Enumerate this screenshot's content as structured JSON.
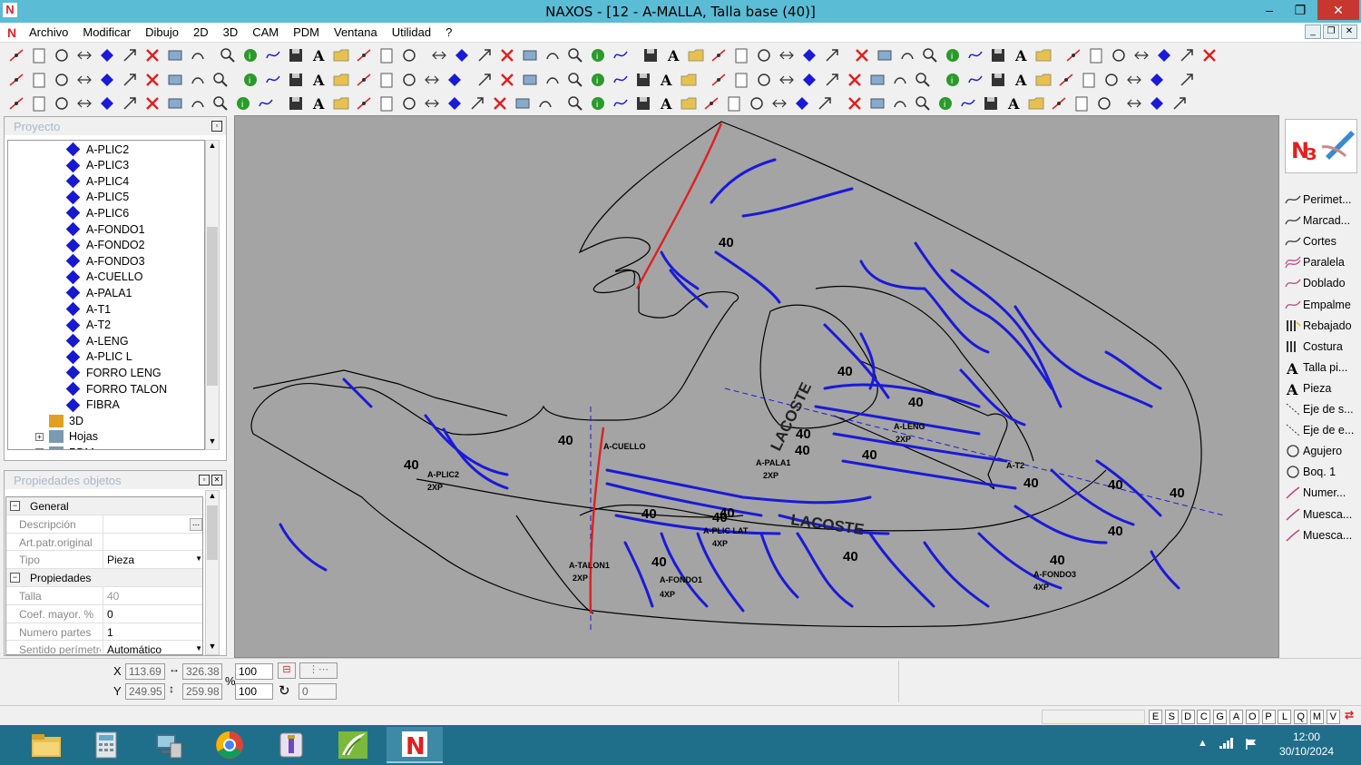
{
  "window": {
    "title": "NAXOS - [12 - A-MALLA, Talla base (40)]",
    "minimize": "–",
    "restore": "❐",
    "close": "✕"
  },
  "menu": {
    "items": [
      "Archivo",
      "Modificar",
      "Dibujo",
      "2D",
      "3D",
      "CAM",
      "PDM",
      "Ventana",
      "Utilidad",
      "?"
    ]
  },
  "project": {
    "header": "Proyecto",
    "items": [
      "A-PLIC2",
      "A-PLIC3",
      "A-PLIC4",
      "A-PLIC5",
      "A-PLIC6",
      "A-FONDO1",
      "A-FONDO2",
      "A-FONDO3",
      "A-CUELLO",
      "A-PALA1",
      "A-T1",
      "A-T2",
      "A-LENG",
      "A-PLIC L",
      "FORRO LENG",
      "FORRO TALON",
      "FIBRA"
    ],
    "folders": [
      "3D",
      "Hojas",
      "PDM"
    ]
  },
  "properties": {
    "header": "Propiedades objetos",
    "rows": [
      {
        "type": "group",
        "key": "General"
      },
      {
        "type": "row",
        "key": "Descripción",
        "value": "",
        "button": "..."
      },
      {
        "type": "row",
        "key": "Art.patr.original",
        "value": ""
      },
      {
        "type": "row",
        "key": "Tipo",
        "value": "Pieza",
        "dropdown": true
      },
      {
        "type": "group",
        "key": "Propiedades"
      },
      {
        "type": "row",
        "key": "Talla",
        "value": "40",
        "gray": true
      },
      {
        "type": "row",
        "key": "Coef. mayor. %",
        "value": "0"
      },
      {
        "type": "row",
        "key": "Numero partes",
        "value": "1"
      },
      {
        "type": "row",
        "key": "Sentido perímetro",
        "value": "Automático",
        "dropdown": true
      }
    ]
  },
  "palette": {
    "items": [
      "Perimet...",
      "Marcad...",
      "Cortes",
      "Paralela",
      "Doblado",
      "Empalme",
      "Rebajado",
      "Costura",
      "Talla pi...",
      "Pieza",
      "Eje de s...",
      "Eje de e...",
      "Agujero",
      "Boq. 1",
      "Numer...",
      "Muesca...",
      "Muesca..."
    ]
  },
  "coords": {
    "x_label": "X",
    "y_label": "Y",
    "x": "113.69",
    "y": "249.95",
    "w": "326.38",
    "h": "259.98",
    "pct_label": "%",
    "scale_x": "100",
    "scale_y": "100",
    "rotation": "0"
  },
  "status": {
    "keys": [
      "E",
      "S",
      "D",
      "C",
      "G",
      "A",
      "O",
      "P",
      "L",
      "Q",
      "M",
      "V"
    ]
  },
  "drawing": {
    "sizes": [
      "40",
      "40",
      "40",
      "40",
      "40",
      "40",
      "40",
      "40",
      "40",
      "40",
      "40",
      "40",
      "40",
      "40",
      "40",
      "40",
      "40",
      "40"
    ],
    "piece_labels": [
      "A-PLIC2",
      "2XP",
      "A-CUELLO",
      "A-LENG",
      "2XP",
      "A-PALA1",
      "2XP",
      "A-T2",
      "A-FONDO1",
      "4XP",
      "A-PLIC LAT",
      "4XP",
      "A-TALON1",
      "2XP",
      "A-FONDO3",
      "4XP",
      "LACOSTE",
      "LACOSTE"
    ]
  },
  "taskbar": {
    "time": "12:00",
    "date": "30/10/2024"
  },
  "colors": {
    "titlebar": "#5bbcd6",
    "canvas": "#a4a4a4",
    "seam_blue": "#1a1ad8",
    "cut_red": "#e02020",
    "taskbar": "#1f6f8a"
  }
}
